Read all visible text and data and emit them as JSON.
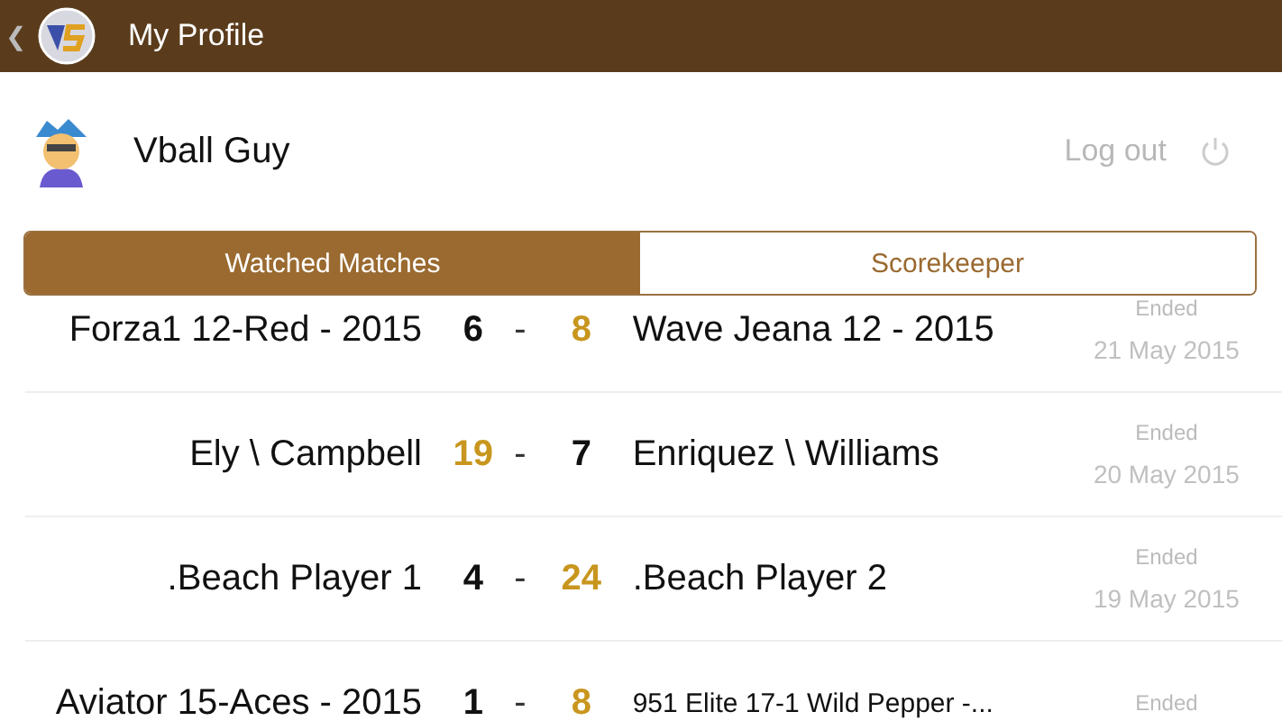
{
  "header": {
    "back": "❮",
    "title": "My Profile"
  },
  "profile": {
    "name": "Vball Guy",
    "logout": "Log out"
  },
  "tabs": [
    {
      "label": "Watched Matches",
      "selected": true
    },
    {
      "label": "Scorekeeper",
      "selected": false
    }
  ],
  "matches": [
    {
      "home": "Forza1 12-Red - 2015",
      "home_score": "6",
      "home_won": false,
      "separator": "-",
      "away_score": "8",
      "away_won": true,
      "away": "Wave Jeana 12 - 2015",
      "status": "Ended",
      "date": "21 May 2015",
      "small": false
    },
    {
      "home": "Ely \\ Campbell",
      "home_score": "19",
      "home_won": true,
      "separator": "-",
      "away_score": "7",
      "away_won": false,
      "away": "Enriquez \\ Williams",
      "status": "Ended",
      "date": "20 May 2015",
      "small": false
    },
    {
      "home": ".Beach Player 1",
      "home_score": "4",
      "home_won": false,
      "separator": "-",
      "away_score": "24",
      "away_won": true,
      "away": ".Beach Player 2",
      "status": "Ended",
      "date": "19 May 2015",
      "small": false
    },
    {
      "home": "Aviator 15-Aces - 2015",
      "home_score": "1",
      "home_won": false,
      "separator": "-",
      "away_score": "8",
      "away_won": true,
      "away": "951 Elite 17-1 Wild Pepper -...",
      "status": "Ended",
      "small": true
    }
  ]
}
